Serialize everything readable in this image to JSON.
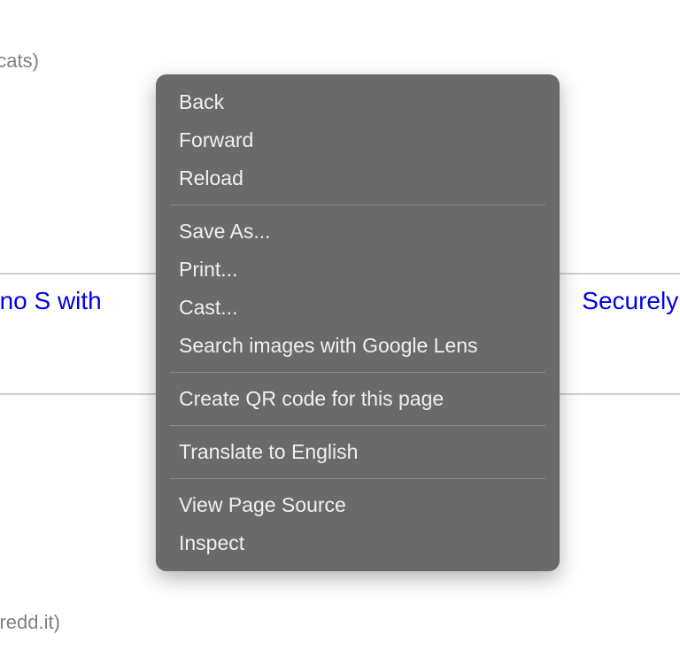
{
  "background": {
    "topFragment": "f.cats)",
    "linkLeft": "ano S with",
    "linkRight": "Securely s",
    "bottomFragment": "v.redd.it)"
  },
  "contextMenu": {
    "groups": [
      [
        {
          "label": "Back",
          "name": "menu-back"
        },
        {
          "label": "Forward",
          "name": "menu-forward"
        },
        {
          "label": "Reload",
          "name": "menu-reload"
        }
      ],
      [
        {
          "label": "Save As...",
          "name": "menu-save-as"
        },
        {
          "label": "Print...",
          "name": "menu-print"
        },
        {
          "label": "Cast...",
          "name": "menu-cast"
        },
        {
          "label": "Search images with Google Lens",
          "name": "menu-search-google-lens"
        }
      ],
      [
        {
          "label": "Create QR code for this page",
          "name": "menu-create-qr"
        }
      ],
      [
        {
          "label": "Translate to English",
          "name": "menu-translate"
        }
      ],
      [
        {
          "label": "View Page Source",
          "name": "menu-view-source"
        },
        {
          "label": "Inspect",
          "name": "menu-inspect"
        }
      ]
    ]
  }
}
